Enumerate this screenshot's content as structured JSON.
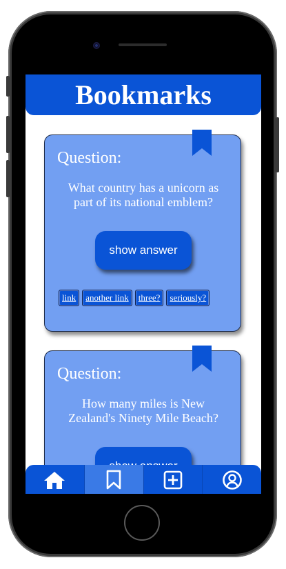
{
  "header": {
    "title": "Bookmarks"
  },
  "cards": [
    {
      "question_label": "Question:",
      "question_text": "What country has a unicorn as part of its national emblem?",
      "answer_button_label": "show answer",
      "links": [
        "link",
        "another link",
        "three?",
        "seriously?"
      ]
    },
    {
      "question_label": "Question:",
      "question_text": "How many miles is New Zealand's Ninety Mile Beach?",
      "answer_button_label": "show answer"
    }
  ],
  "nav": {
    "items": [
      {
        "icon": "home-icon",
        "active": false
      },
      {
        "icon": "bookmark-icon",
        "active": true
      },
      {
        "icon": "add-square-icon",
        "active": false
      },
      {
        "icon": "user-circle-icon",
        "active": false
      }
    ]
  },
  "colors": {
    "primary": "#0a54d6",
    "card": "#729ff2",
    "nav_active": "#3a7ae6"
  }
}
